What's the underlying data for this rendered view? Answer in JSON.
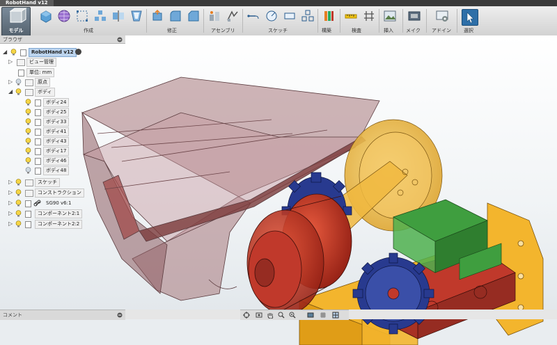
{
  "window": {
    "tab_title": "RobotHand v12"
  },
  "toolbar": {
    "workspace_label": "モデル",
    "groups": {
      "create": "作成",
      "modify": "修正",
      "assemble": "アセンブリ",
      "sketch": "スケッチ",
      "construct": "構築",
      "inspect": "検査",
      "insert": "挿入",
      "make": "メイク",
      "addins": "アドイン",
      "select": "選択"
    }
  },
  "browser": {
    "title": "ブラウザ",
    "root": "RobotHand v12",
    "items": [
      {
        "label": "ビュー管理"
      },
      {
        "label": "単位: mm"
      },
      {
        "label": "原点"
      },
      {
        "label": "ボディ"
      },
      {
        "label": "ボディ24"
      },
      {
        "label": "ボディ25"
      },
      {
        "label": "ボディ33"
      },
      {
        "label": "ボディ41"
      },
      {
        "label": "ボディ43"
      },
      {
        "label": "ボディ17"
      },
      {
        "label": "ボディ46"
      },
      {
        "label": "ボディ48"
      },
      {
        "label": "スケッチ"
      },
      {
        "label": "コンストラクション"
      },
      {
        "label": "SG90 v6:1"
      },
      {
        "label": "コンポーネント2:1"
      },
      {
        "label": "コンポーネント2:2"
      }
    ]
  },
  "comments": {
    "title": "コメント"
  },
  "colors": {
    "accent": "#2e6fa8",
    "housing": "#a7787c",
    "gear_red": "#c0392b",
    "gear_blue": "#283a8f",
    "gear_yellow": "#f0b840",
    "servo_green": "#3f9e3f",
    "bracket_orange": "#f3b52d"
  }
}
